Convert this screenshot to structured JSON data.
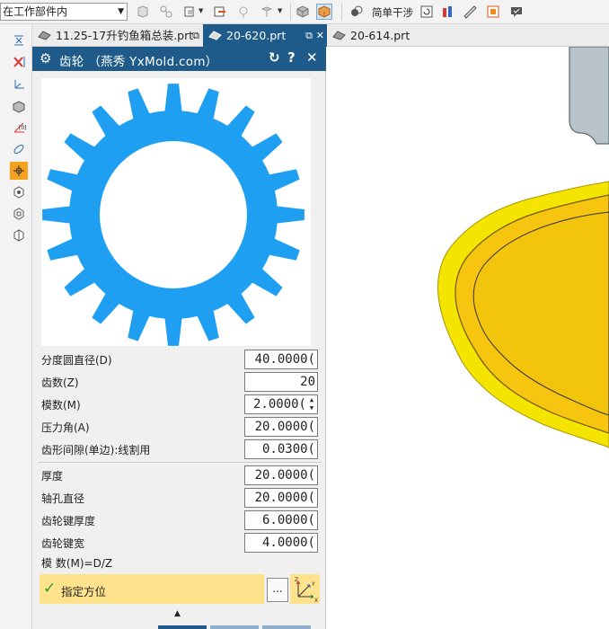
{
  "toolbar": {
    "filter_value": "在工作部件内",
    "simple_interference_label": "简单干涉"
  },
  "tabs": [
    {
      "label": "11.25-17升钓鱼箱总装.prt"
    },
    {
      "label": "20-620.prt"
    },
    {
      "label": "20-614.prt"
    }
  ],
  "dialog": {
    "title": "齿轮 （燕秀 YxMold.com）",
    "fields": [
      {
        "label": "分度圆直径(D)",
        "value": "40.0000("
      },
      {
        "label": "齿数(Z)",
        "value": "20"
      },
      {
        "label": "模数(M)",
        "value": "2.0000("
      },
      {
        "label": "压力角(A)",
        "value": "20.0000("
      },
      {
        "label": "齿形间隙(单边):线割用",
        "value": "0.0300("
      },
      {
        "label": "厚度",
        "value": "20.0000("
      },
      {
        "label": "轴孔直径",
        "value": "20.0000("
      },
      {
        "label": "齿轮键厚度",
        "value": "6.0000("
      },
      {
        "label": "齿轮键宽",
        "value": "4.0000("
      }
    ],
    "formula": "模 数(M)=D/Z",
    "specify_orientation": "指定方位",
    "dots_label": "..."
  },
  "colors": {
    "accent": "#1e5b8a",
    "gear": "#1e9ff2",
    "highlight": "#ffe28c",
    "part_yellow": "#f5e400"
  }
}
